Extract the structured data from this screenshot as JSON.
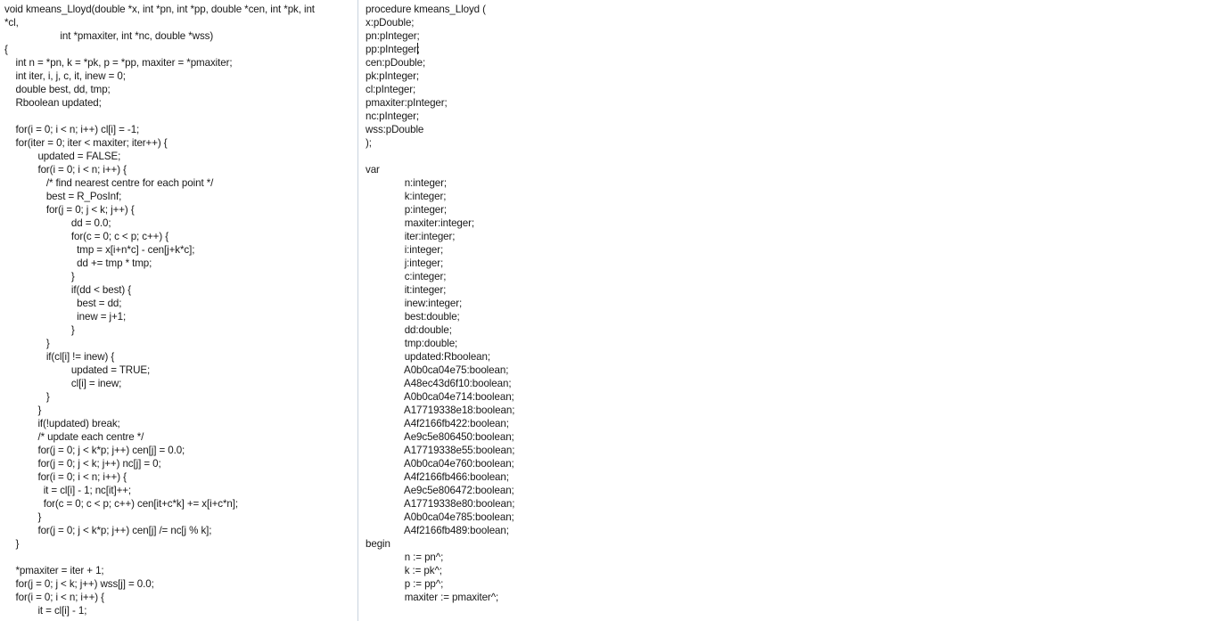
{
  "window": {
    "title": "kmeans_Lloyd code comparison",
    "divider_color": "#c9d3de",
    "background_color": "#ffffff",
    "text_color": "#181818"
  },
  "left_pane": {
    "name": "c-source-pane",
    "language": "C",
    "lines": [
      "void kmeans_Lloyd(double *x, int *pn, int *pp, double *cen, int *pk, int",
      "*cl,",
      "                    int *pmaxiter, int *nc, double *wss)",
      "{",
      "    int n = *pn, k = *pk, p = *pp, maxiter = *pmaxiter;",
      "    int iter, i, j, c, it, inew = 0;",
      "    double best, dd, tmp;",
      "    Rboolean updated;",
      "",
      "    for(i = 0; i < n; i++) cl[i] = -1;",
      "    for(iter = 0; iter < maxiter; iter++) {",
      "            updated = FALSE;",
      "            for(i = 0; i < n; i++) {",
      "               /* find nearest centre for each point */",
      "               best = R_PosInf;",
      "               for(j = 0; j < k; j++) {",
      "                        dd = 0.0;",
      "                        for(c = 0; c < p; c++) {",
      "                          tmp = x[i+n*c] - cen[j+k*c];",
      "                          dd += tmp * tmp;",
      "                        }",
      "                        if(dd < best) {",
      "                          best = dd;",
      "                          inew = j+1;",
      "                        }",
      "               }",
      "               if(cl[i] != inew) {",
      "                        updated = TRUE;",
      "                        cl[i] = inew;",
      "               }",
      "            }",
      "            if(!updated) break;",
      "            /* update each centre */",
      "            for(j = 0; j < k*p; j++) cen[j] = 0.0;",
      "            for(j = 0; j < k; j++) nc[j] = 0;",
      "            for(i = 0; i < n; i++) {",
      "              it = cl[i] - 1; nc[it]++;",
      "              for(c = 0; c < p; c++) cen[it+c*k] += x[i+c*n];",
      "            }",
      "            for(j = 0; j < k*p; j++) cen[j] /= nc[j % k];",
      "    }",
      "",
      "    *pmaxiter = iter + 1;",
      "    for(j = 0; j < k; j++) wss[j] = 0.0;",
      "    for(i = 0; i < n; i++) {",
      "            it = cl[i] - 1;"
    ]
  },
  "right_pane": {
    "name": "pascal-source-pane",
    "language": "Pascal",
    "caret_line_index": 3,
    "caret_after_text": "pp:pInteger",
    "caret_rest_text": ";",
    "lines": [
      "procedure kmeans_Lloyd (",
      "x:pDouble;",
      "pn:pInteger;",
      "pp:pInteger;",
      "cen:pDouble;",
      "pk:pInteger;",
      "cl:pInteger;",
      "pmaxiter:pInteger;",
      "nc:pInteger;",
      "wss:pDouble",
      ");",
      "",
      "var",
      "              n:integer;",
      "              k:integer;",
      "              p:integer;",
      "              maxiter:integer;",
      "              iter:integer;",
      "              i:integer;",
      "              j:integer;",
      "              c:integer;",
      "              it:integer;",
      "              inew:integer;",
      "              best:double;",
      "              dd:double;",
      "              tmp:double;",
      "              updated:Rboolean;",
      "              A0b0ca04e75:boolean;",
      "              A48ec43d6f10:boolean;",
      "              A0b0ca04e714:boolean;",
      "              A17719338e18:boolean;",
      "              A4f2166fb422:boolean;",
      "              Ae9c5e806450:boolean;",
      "              A17719338e55:boolean;",
      "              A0b0ca04e760:boolean;",
      "              A4f2166fb466:boolean;",
      "              Ae9c5e806472:boolean;",
      "              A17719338e80:boolean;",
      "              A0b0ca04e785:boolean;",
      "              A4f2166fb489:boolean;",
      "begin",
      "              n := pn^;",
      "              k := pk^;",
      "              p := pp^;",
      "              maxiter := pmaxiter^;"
    ]
  }
}
